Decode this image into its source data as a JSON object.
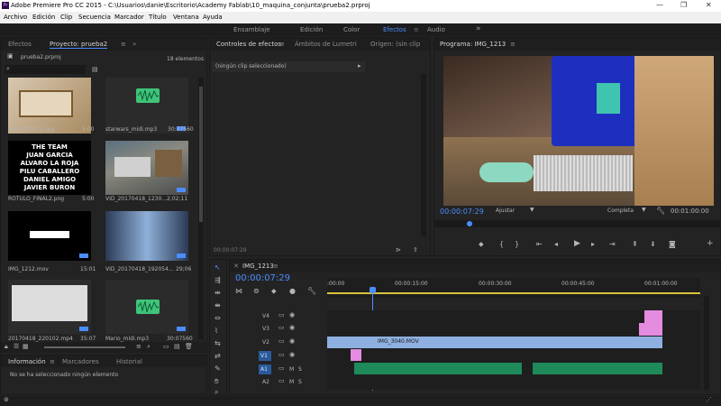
{
  "app": {
    "title": "Adobe Premiere Pro CC 2015 - C:\\Usuarios\\danie\\Escritorio\\Academy Fablab\\10_maquina_conjunta\\prueba2.prproj",
    "logo": "Pr"
  },
  "menu": [
    "Archivo",
    "Edición",
    "Clip",
    "Secuencia",
    "Marcador",
    "Título",
    "Ventana",
    "Ayuda"
  ],
  "workspaces": {
    "items": [
      "Ensamblaje",
      "Edición",
      "Color",
      "Efectos",
      "Audio"
    ],
    "active": "Efectos",
    "more": "»"
  },
  "project": {
    "tabs": [
      "Efectos",
      "Proyecto: prueba2"
    ],
    "file": "prueba2.prproj",
    "count": "18 elementos",
    "items": [
      {
        "name": "img_2832 (1).jpg",
        "duration": "5:00"
      },
      {
        "name": "starwars_midi.mp3",
        "duration": "30:07560"
      },
      {
        "name": "ROTULO_FINAL2.png",
        "duration": "5:00"
      },
      {
        "name": "VID_20170418_1230...",
        "duration": "2;02;11"
      },
      {
        "name": "IMG_1212.mov",
        "duration": "15:01"
      },
      {
        "name": "VID_20170418_192054...",
        "duration": "29;06"
      },
      {
        "name": "20170418_220102.mp4",
        "duration": "35:07"
      },
      {
        "name": "Mario_midi.mp3",
        "duration": "30:07560"
      }
    ],
    "credits": [
      "THE TEAM",
      "JUAN GARCIA",
      "ALVARO LA ROJA",
      "PILU CABALLERO",
      "DANIEL AMIGO",
      "JAVIER BURON"
    ]
  },
  "info": {
    "tabs": [
      "Información",
      "Marcadores",
      "Historial"
    ],
    "message": "No se ha seleccionado ningún elemento"
  },
  "effects_controls": {
    "tabs": [
      "Controles de efectos",
      "Ámbitos de Lumetri",
      "Origen: (sin clip"
    ],
    "no_clip": "(ningún clip seleccionado)",
    "time": "00:00:07:29"
  },
  "program": {
    "tab": "Programa: IMG_1213",
    "timecode": "00:00:07:29",
    "fit": "Ajustar",
    "quality": "Completa",
    "duration": "00:01:00:00"
  },
  "timeline": {
    "tab": "IMG_1213",
    "timecode": "00:00:07:29",
    "ruler": [
      ":00:00",
      "00:00:15:00",
      "00:00:30:00",
      "00:00:45:00",
      "00:01:00:00"
    ],
    "tracks": [
      "V4",
      "V3",
      "V2",
      "V1",
      "A1",
      "A2"
    ],
    "clip_label": "IMG_3040.MOV",
    "track_buttons": [
      "M",
      "S"
    ]
  },
  "colors": {
    "accent": "#4b8dff",
    "video_clip": "#8eb0e0",
    "audio_clip": "#1f8a5a",
    "pink_clip": "#e58be0"
  }
}
